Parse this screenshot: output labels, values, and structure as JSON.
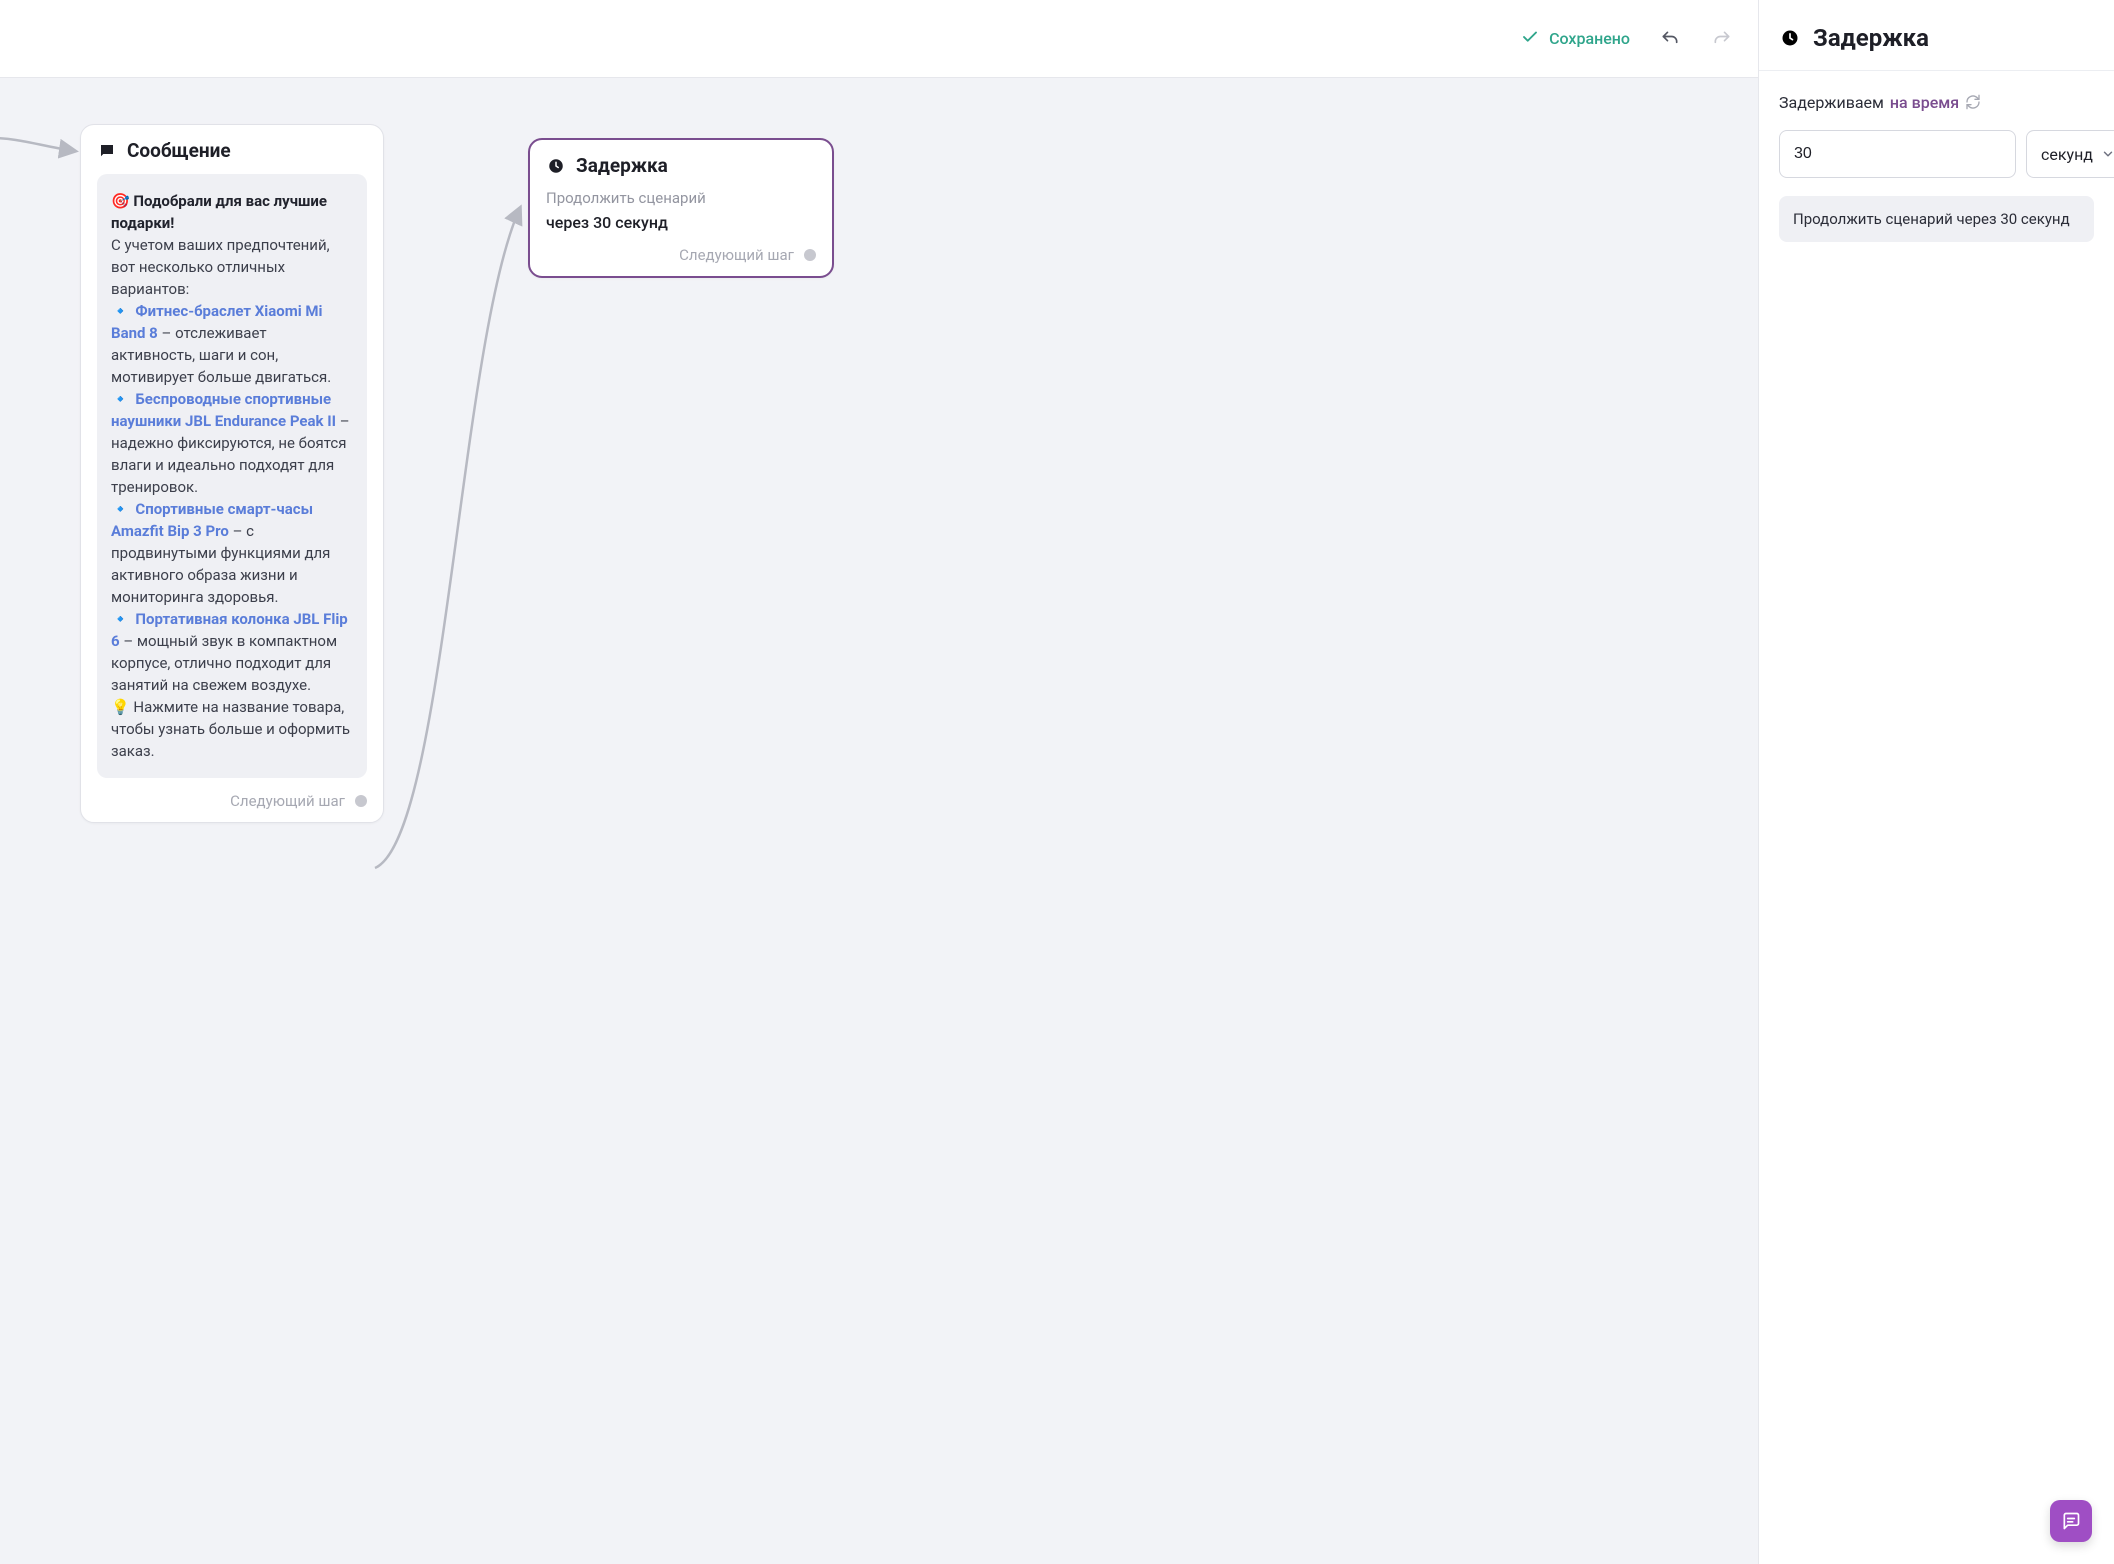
{
  "topbar": {
    "saved_label": "Сохранено"
  },
  "nodes": {
    "message": {
      "title": "Сообщение",
      "next_step_label": "Следующий шаг",
      "body": {
        "headline": "🎯 Подобрали для вас лучшие подарки!",
        "intro": "С учетом ваших предпочтений, вот несколько отличных вариантов:",
        "items": [
          {
            "name": "Фитнес-браслет Xiaomi Mi Band 8",
            "desc": " – отслеживает активность, шаги и сон, мотивирует больше двигаться."
          },
          {
            "name": "Беспроводные спортивные наушники JBL Endurance Peak II",
            "desc": " – надежно фиксируются, не боятся влаги и идеально подходят для тренировок."
          },
          {
            "name": "Спортивные смарт-часы Amazfit Bip 3 Pro",
            "desc": " – с продвинутыми функциями для активного образа жизни и мониторинга здоровья."
          },
          {
            "name": "Портативная колонка JBL Flip 6",
            "desc": " – мощный звук в компактном корпусе, отлично подходит для занятий на свежем воздухе."
          }
        ],
        "hint": "💡 Нажмите на название товара, чтобы узнать больше и оформить заказ."
      }
    },
    "delay": {
      "title": "Задержка",
      "subtitle": "Продолжить сценарий",
      "value_text": "через 30 секунд",
      "next_step_label": "Следующий шаг"
    }
  },
  "sidepanel": {
    "title": "Задержка",
    "mode_label": "Задерживаем",
    "mode_value": "на время",
    "value": "30",
    "unit": "секунд",
    "summary": "Продолжить сценарий через 30 секунд"
  }
}
